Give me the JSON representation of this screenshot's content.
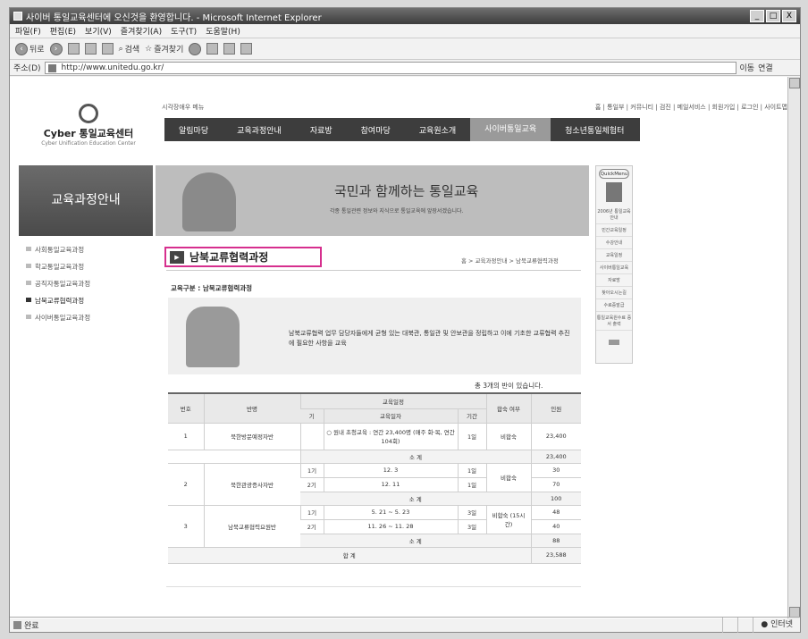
{
  "window": {
    "title": "사이버 통일교육센터에 오신것을 환영합니다. - Microsoft Internet Explorer",
    "controls": [
      "_",
      "□",
      "X"
    ]
  },
  "menu": [
    "파일(F)",
    "편집(E)",
    "보기(V)",
    "즐겨찾기(A)",
    "도구(T)",
    "도움말(H)"
  ],
  "toolbar": {
    "back": "뒤로",
    "search": "검색",
    "favorites": "즐겨찾기"
  },
  "address": {
    "label": "주소(D)",
    "url": "http://www.unitedu.go.kr/",
    "go": "이동",
    "links": "연결"
  },
  "status": {
    "left": "완료",
    "zone": "인터넷"
  },
  "site": {
    "logo_name": "Cyber 통일교육센터",
    "logo_sub": "Cyber Unification Education Center",
    "skip_menu": "시각장애우 메뉴",
    "top_links": "홈 | 통일부 | 커뮤니티 | 검진 | 메일서비스 | 회원가입 | 로그인 | 사이트맵",
    "gnb": [
      "알림마당",
      "교육과정안내",
      "자료방",
      "참여마당",
      "교육원소개",
      "사이버통일교육",
      "청소년통일체험터"
    ],
    "left_banner": "교육과정안내",
    "banner_slogan": "국민과 함께하는 통일교육",
    "banner_sub": "각종 통일관련 정보와 지식으로 통일교육에 앞장서겠습니다.",
    "left_nav": [
      "사회통일교육과정",
      "학교통일교육과정",
      "공직자통일교육과정",
      "남북교류협력과정",
      "사이버통일교육과정"
    ],
    "quick_title": "QuickMenu",
    "quick_items": [
      "2006년 통일교육안내",
      "민간교육일정",
      "수강안내",
      "교육일정",
      "사이버통일교육",
      "자료방",
      "찾아오시는길",
      "수료증발급",
      "통일교육원수료 증서 출력"
    ],
    "page_title": "남북교류협력과정",
    "breadcrumb": "홈 > 교육과정안내 > 남북교류협력과정",
    "section_label": "교육구분 : 남북교류협력과정",
    "description": "남북교류협력 업무 담당자들에게 균형 있는 대북관, 통일관 및 안보관을 정립하고 이에 기초한 교류협력 추진에 필요한 사항을 교육",
    "count_text": "총 3개의 반이 있습니다."
  },
  "table": {
    "headers": {
      "no": "번호",
      "class": "반명",
      "schedule": "교육일정",
      "term": "기",
      "dates": "교육일자",
      "period": "기간",
      "lodging": "합숙 여부",
      "people": "인원"
    },
    "rows": [
      {
        "no": "1",
        "class": "북한방문예정자반",
        "term": "",
        "dates": "○ 원내 초청교육 : 연간 23,400명 (매주 화·목, 연간 104회)",
        "period": "1일",
        "lodging": "비합숙",
        "people": "23,400"
      },
      {
        "no": "2",
        "class": "북한관광증사자반",
        "term1": "1기",
        "dates1": "12. 3",
        "period1": "1일",
        "term2": "2기",
        "dates2": "12. 11",
        "period2": "1일",
        "lodging": "비합숙",
        "people1": "30",
        "people2": "70"
      },
      {
        "no": "3",
        "class": "남북교류협력요원반",
        "term1": "1기",
        "dates1": "5. 21 ~ 5. 23",
        "period1": "3일",
        "term2": "2기",
        "dates2": "11. 26 ~ 11. 28",
        "period2": "3일",
        "lodging": "비합숙 (15시간)",
        "people1": "48",
        "people2": "40"
      }
    ],
    "subtotal_label": "소 계",
    "subtotals": [
      "23,400",
      "100",
      "88"
    ],
    "total_label": "합 계",
    "total": "23,588"
  }
}
